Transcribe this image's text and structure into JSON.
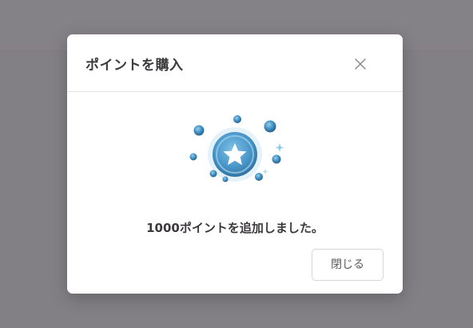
{
  "modal": {
    "title": "ポイントを購入",
    "close_icon": "close-icon",
    "illustration_icon": "star-coin-icon",
    "message": "1000ポイントを追加しました。",
    "close_button_label": "閉じる"
  },
  "colors": {
    "overlay": "#5c585e",
    "coin": "#3f8cc0",
    "coin_light": "#7cc0e6",
    "text": "#3c3a3d"
  }
}
